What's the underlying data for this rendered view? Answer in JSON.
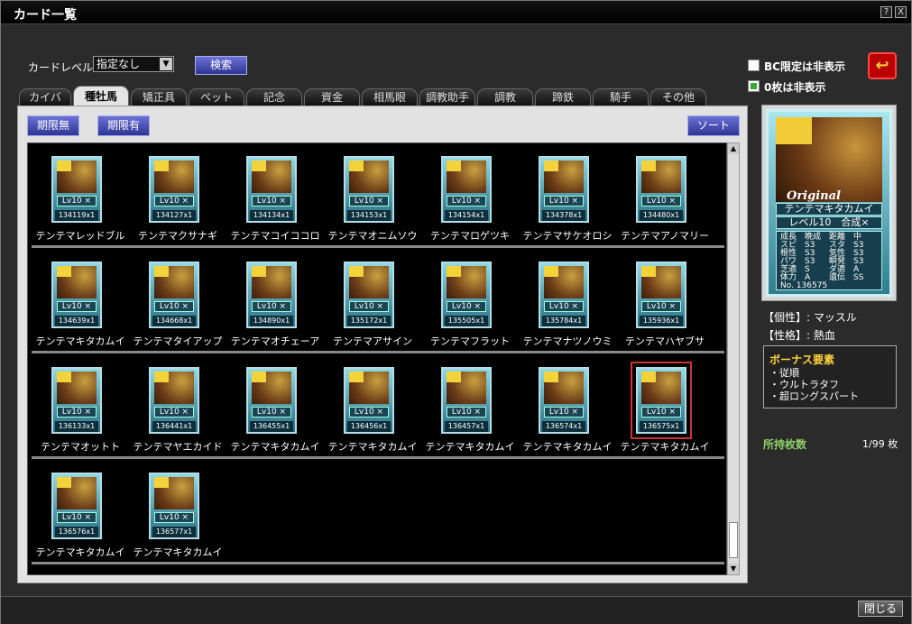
{
  "window": {
    "title": "カード一覧",
    "help_label": "?",
    "close_label": "X"
  },
  "filters": {
    "level_label": "カードレベル:",
    "level_value": "指定なし",
    "search_label": "検索"
  },
  "tabs": [
    "カイバ",
    "種牡馬",
    "矯正具",
    "ペット",
    "記念",
    "資金",
    "相馬眼",
    "調教助手",
    "調教",
    "蹄鉄",
    "騎手",
    "その他"
  ],
  "active_tab": 1,
  "subtabs": {
    "unlimited": "期限無",
    "limited": "期限有",
    "sort": "ソート"
  },
  "cards": [
    {
      "lv": "Lv10 ×",
      "id": "134119x1",
      "name": "テンテマレッドブル"
    },
    {
      "lv": "Lv10 ×",
      "id": "134127x1",
      "name": "テンテマクサナギ"
    },
    {
      "lv": "Lv10 ×",
      "id": "134134x1",
      "name": "テンテマコイココロ"
    },
    {
      "lv": "Lv10 ×",
      "id": "134153x1",
      "name": "テンテマオニムソウ"
    },
    {
      "lv": "Lv10 ×",
      "id": "134154x1",
      "name": "テンテマロゲツキ"
    },
    {
      "lv": "Lv10 ×",
      "id": "134378x1",
      "name": "テンテマサケオロシ"
    },
    {
      "lv": "Lv10 ×",
      "id": "134480x1",
      "name": "テンテマアノマリー"
    },
    {
      "lv": "Lv10 ×",
      "id": "134639x1",
      "name": "テンテマキタカムイ"
    },
    {
      "lv": "Lv10 ×",
      "id": "134668x1",
      "name": "テンテマタイアップ"
    },
    {
      "lv": "Lv10 ×",
      "id": "134890x1",
      "name": "テンテマオチェーア"
    },
    {
      "lv": "Lv10 ×",
      "id": "135172x1",
      "name": "テンテマアサイン"
    },
    {
      "lv": "Lv10 ×",
      "id": "135505x1",
      "name": "テンテマフラット"
    },
    {
      "lv": "Lv10 ×",
      "id": "135784x1",
      "name": "テンテマナツノウミ"
    },
    {
      "lv": "Lv10 ×",
      "id": "135936x1",
      "name": "テンテマハヤブサ"
    },
    {
      "lv": "Lv10 ×",
      "id": "136133x1",
      "name": "テンテマオットト"
    },
    {
      "lv": "Lv10 ×",
      "id": "136441x1",
      "name": "テンテマヤエカイド"
    },
    {
      "lv": "Lv10 ×",
      "id": "136455x1",
      "name": "テンテマキタカムイ"
    },
    {
      "lv": "Lv10 ×",
      "id": "136456x1",
      "name": "テンテマキタカムイ"
    },
    {
      "lv": "Lv10 ×",
      "id": "136457x1",
      "name": "テンテマキタカムイ"
    },
    {
      "lv": "Lv10 ×",
      "id": "136574x1",
      "name": "テンテマキタカムイ"
    },
    {
      "lv": "Lv10 ×",
      "id": "136575x1",
      "name": "テンテマキタカムイ",
      "selected": true
    },
    {
      "lv": "Lv10 ×",
      "id": "136576x1",
      "name": "テンテマキタカムイ"
    },
    {
      "lv": "Lv10 ×",
      "id": "136577x1",
      "name": "テンテマキタカムイ"
    }
  ],
  "options": {
    "hide_bc_label": "BC限定は非表示",
    "hide_zero_label": "0枚は非表示",
    "hide_bc": false,
    "hide_zero": true
  },
  "detail": {
    "card_label": "Original",
    "name": "テンテマキタカムイ",
    "level_line": "レベル10　合成×",
    "stats": [
      [
        "成長",
        "晩成",
        "距離",
        "中"
      ],
      [
        "スピ",
        "S3",
        "スタ",
        "S3"
      ],
      [
        "根性",
        "S3",
        "気性",
        "S3"
      ],
      [
        "パワ",
        "S3",
        "瞬発",
        "S3"
      ],
      [
        "芝適",
        "S",
        "ダ適",
        "A"
      ],
      [
        "体力",
        "A",
        "遺伝",
        "SS"
      ]
    ],
    "number": "No. 136575",
    "personality": "【個性】: マッスル",
    "trait": "【性格】: 熱血"
  },
  "bonus": {
    "title": "ボーナス要素",
    "items": [
      "・従順",
      "・ウルトラタフ",
      "・超ロングスパート"
    ]
  },
  "owned": {
    "label": "所持枚数",
    "value": "1/99 枚"
  },
  "footer": {
    "close_label": "閉じる"
  }
}
